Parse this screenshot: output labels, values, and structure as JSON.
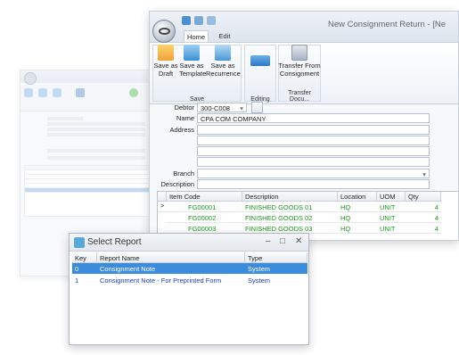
{
  "main_window": {
    "title": "New Consignment Return - [Ne",
    "tabs": [
      "Home",
      "Edit"
    ],
    "ribbon": {
      "save_group_label": "Save",
      "save_as_draft": "Save as Draft",
      "save_as_template": "Save as Template",
      "save_as_recurrence": "Save as Recurrence",
      "editing_group_label": "Editing",
      "transfer_from_consignment": "Transfer From Consignment",
      "transfer_group_label": "Transfer Docu..."
    },
    "form": {
      "debtor_label": "Debtor",
      "debtor_value": "300-C008",
      "name_label": "Name",
      "name_value": "CPA COM COMPANY",
      "address_label": "Address",
      "branch_label": "Branch",
      "description_label": "Description"
    },
    "grid": {
      "columns": [
        "Item Code",
        "Description",
        "Location",
        "UOM",
        "Qty"
      ],
      "rows": [
        {
          "item_code": "FG00001",
          "description": "FINISHED GOODS 01",
          "location": "HQ",
          "uom": "UNIT",
          "qty": "4"
        },
        {
          "item_code": "FG00002",
          "description": "FINISHED GOODS 02",
          "location": "HQ",
          "uom": "UNIT",
          "qty": "4"
        },
        {
          "item_code": "FG00003",
          "description": "FINISHED GOODS 03",
          "location": "HQ",
          "uom": "UNIT",
          "qty": "4"
        }
      ]
    }
  },
  "dialog": {
    "title": "Select Report",
    "controls": {
      "minimize": "–",
      "maximize": "□",
      "close": "✕"
    },
    "columns": [
      "Key",
      "Report Name",
      "Type"
    ],
    "rows": [
      {
        "key": "0",
        "report_name": "Consignment Note",
        "type": "System"
      },
      {
        "key": "1",
        "report_name": "Consignment Note - For Preprinted Form",
        "type": "System"
      }
    ]
  },
  "colors": {
    "selection": "#3c8cde",
    "grid_green": "#1d9a1d",
    "link_blue": "#1a3fc7"
  }
}
